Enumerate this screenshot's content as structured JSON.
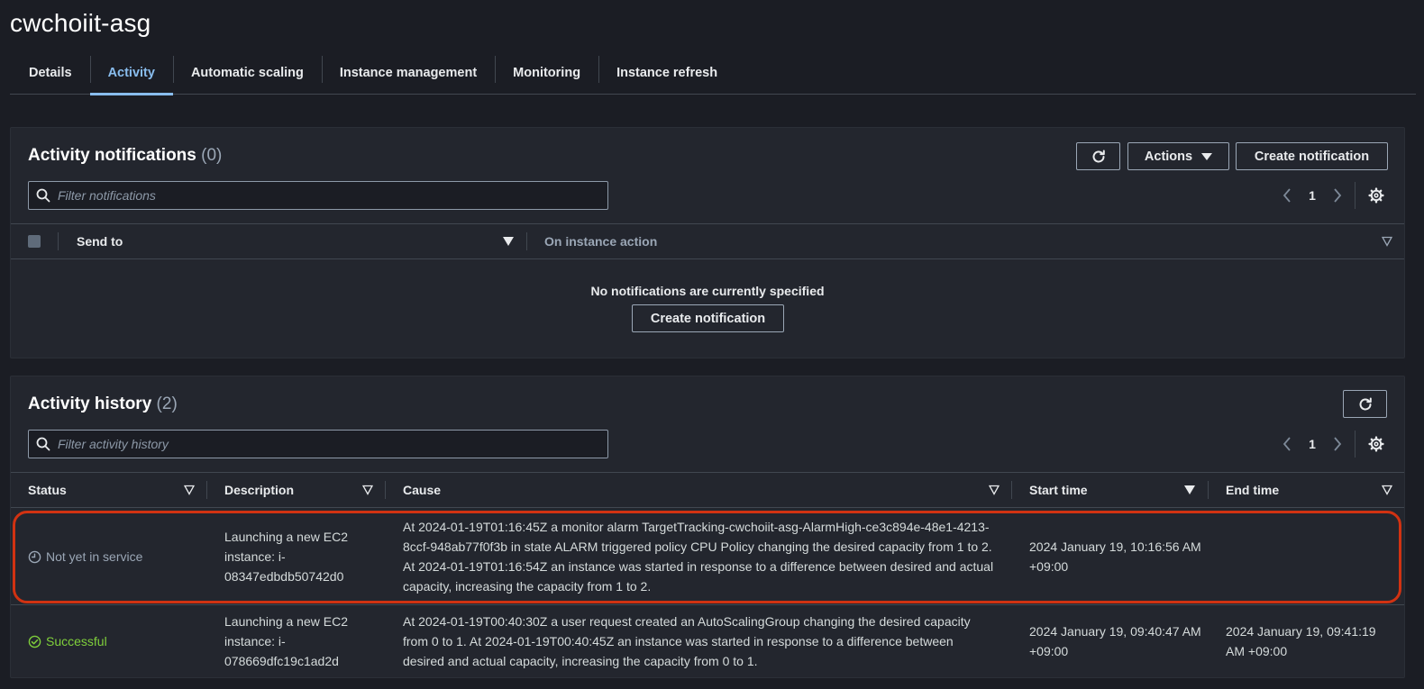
{
  "page": {
    "title": "cwchoiit-asg"
  },
  "tabs": [
    {
      "label": "Details"
    },
    {
      "label": "Activity"
    },
    {
      "label": "Automatic scaling"
    },
    {
      "label": "Instance management"
    },
    {
      "label": "Monitoring"
    },
    {
      "label": "Instance refresh"
    }
  ],
  "active_tab": "Activity",
  "notifications": {
    "title": "Activity notifications",
    "count": "(0)",
    "refresh_icon": "refresh-icon",
    "actions_label": "Actions",
    "create_label": "Create notification",
    "search_placeholder": "Filter notifications",
    "page": "1",
    "columns": {
      "send_to": "Send to",
      "on_instance_action": "On instance action"
    },
    "empty_text": "No notifications are currently specified",
    "empty_create_label": "Create notification"
  },
  "history": {
    "title": "Activity history",
    "count": "(2)",
    "search_placeholder": "Filter activity history",
    "page": "1",
    "columns": {
      "status": "Status",
      "description": "Description",
      "cause": "Cause",
      "start_time": "Start time",
      "end_time": "End time"
    },
    "rows": [
      {
        "status": "Not yet in service",
        "status_icon": "clock-icon",
        "description": "Launching a new EC2 instance: i-08347edbdb50742d0",
        "cause": "At 2024-01-19T01:16:45Z a monitor alarm TargetTracking-cwchoiit-asg-AlarmHigh-ce3c894e-48e1-4213-8ccf-948ab77f0f3b in state ALARM triggered policy CPU Policy changing the desired capacity from 1 to 2. At 2024-01-19T01:16:54Z an instance was started in response to a difference between desired and actual capacity, increasing the capacity from 1 to 2.",
        "start_time": "2024 January 19, 10:16:56 AM +09:00",
        "end_time": ""
      },
      {
        "status": "Successful",
        "status_icon": "check-circle-icon",
        "description": "Launching a new EC2 instance: i-078669dfc19c1ad2d",
        "cause": "At 2024-01-19T00:40:30Z a user request created an AutoScalingGroup changing the desired capacity from 0 to 1. At 2024-01-19T00:40:45Z an instance was started in response to a difference between desired and actual capacity, increasing the capacity from 0 to 1.",
        "start_time": "2024 January 19, 09:40:47 AM +09:00",
        "end_time": "2024 January 19, 09:41:19 AM +09:00"
      }
    ]
  },
  "colors": {
    "background": "#1b1d24",
    "panel": "#23262e",
    "accent": "#89bdee",
    "success": "#7fcf3b",
    "highlight": "#d13212"
  }
}
